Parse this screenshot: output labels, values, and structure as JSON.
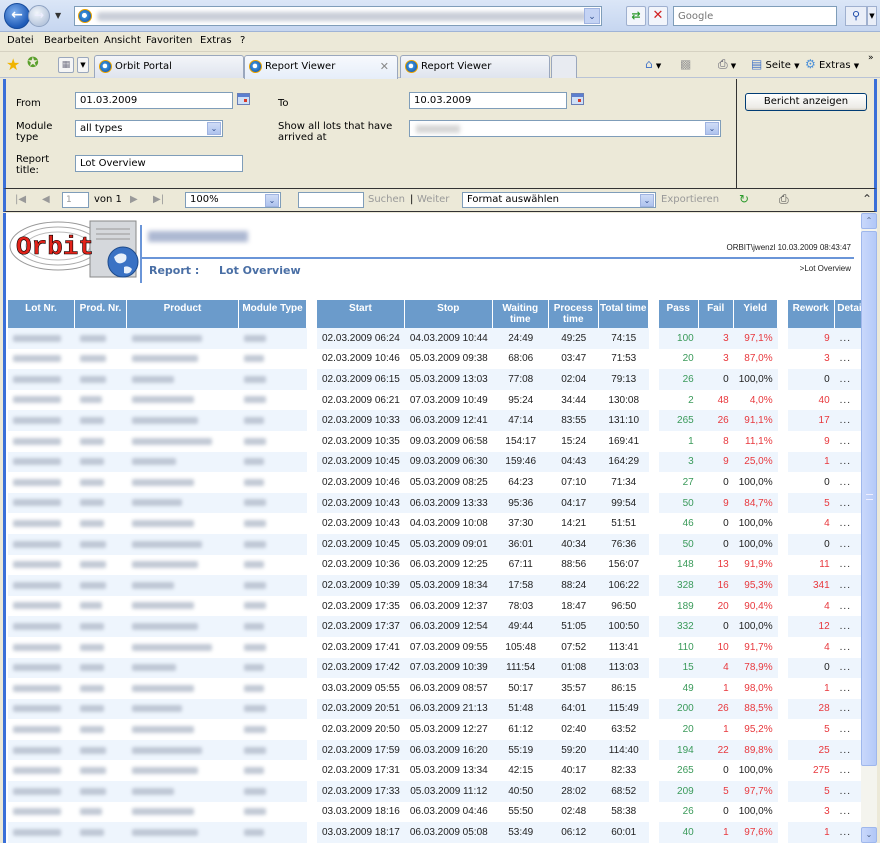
{
  "browser": {
    "address_placeholder": "",
    "search_placeholder": "Google",
    "menu": [
      "Datei",
      "Bearbeiten",
      "Ansicht",
      "Favoriten",
      "Extras",
      "?"
    ],
    "tabs": [
      {
        "label": "Orbit Portal",
        "active": false
      },
      {
        "label": "Report Viewer",
        "active": true
      },
      {
        "label": "Report Viewer",
        "active": false
      }
    ],
    "commands": {
      "page": "Seite",
      "tools": "Extras"
    }
  },
  "params": {
    "from_label": "From",
    "from_value": "01.03.2009",
    "to_label": "To",
    "to_value": "10.03.2009",
    "module_type_label": "Module type",
    "module_type_value": "all types",
    "arrived_label": "Show all lots that have arrived at",
    "report_title_label": "Report title:",
    "report_title_value": "Lot Overview",
    "view_report_button": "Bericht anzeigen"
  },
  "toolbar": {
    "page_value": "1",
    "page_of": "von 1",
    "zoom": "100%",
    "find": "Suchen",
    "separator": "|",
    "next": "Weiter",
    "format": "Format auswählen",
    "export": "Exportieren"
  },
  "report": {
    "report_label": "Report :",
    "report_title": "Lot Overview",
    "user_stamp": "ORBIT\\jwenzl 10.03.2009 08:43:47",
    "breadcrumb": ">Lot Overview",
    "logo_text": "Orbit",
    "columns": [
      "Lot Nr.",
      "Prod. Nr.",
      "Product",
      "Module Type",
      "Start",
      "Stop",
      "Waiting time",
      "Process time",
      "Total time",
      "Pass",
      "Fail",
      "Yield",
      "Rework",
      "Details"
    ],
    "details_label": "...",
    "rows": [
      {
        "start": "02.03.2009 06:24",
        "stop": "04.03.2009 10:44",
        "wait": "24:49",
        "proc": "49:25",
        "total": "74:15",
        "pass": "100",
        "fail": "3",
        "yield": "97,1%",
        "rework": "9"
      },
      {
        "start": "02.03.2009 10:46",
        "stop": "05.03.2009 09:38",
        "wait": "68:06",
        "proc": "03:47",
        "total": "71:53",
        "pass": "20",
        "fail": "3",
        "yield": "87,0%",
        "rework": "3"
      },
      {
        "start": "02.03.2009 06:15",
        "stop": "05.03.2009 13:03",
        "wait": "77:08",
        "proc": "02:04",
        "total": "79:13",
        "pass": "26",
        "fail": "0",
        "yield": "100,0%",
        "rework": "0"
      },
      {
        "start": "02.03.2009 06:21",
        "stop": "07.03.2009 10:49",
        "wait": "95:24",
        "proc": "34:44",
        "total": "130:08",
        "pass": "2",
        "fail": "48",
        "yield": "4,0%",
        "rework": "40"
      },
      {
        "start": "02.03.2009 10:33",
        "stop": "06.03.2009 12:41",
        "wait": "47:14",
        "proc": "83:55",
        "total": "131:10",
        "pass": "265",
        "fail": "26",
        "yield": "91,1%",
        "rework": "17"
      },
      {
        "start": "02.03.2009 10:35",
        "stop": "09.03.2009 06:58",
        "wait": "154:17",
        "proc": "15:24",
        "total": "169:41",
        "pass": "1",
        "fail": "8",
        "yield": "11,1%",
        "rework": "9"
      },
      {
        "start": "02.03.2009 10:45",
        "stop": "09.03.2009 06:30",
        "wait": "159:46",
        "proc": "04:43",
        "total": "164:29",
        "pass": "3",
        "fail": "9",
        "yield": "25,0%",
        "rework": "1"
      },
      {
        "start": "02.03.2009 10:46",
        "stop": "05.03.2009 08:25",
        "wait": "64:23",
        "proc": "07:10",
        "total": "71:34",
        "pass": "27",
        "fail": "0",
        "yield": "100,0%",
        "rework": "0"
      },
      {
        "start": "02.03.2009 10:43",
        "stop": "06.03.2009 13:33",
        "wait": "95:36",
        "proc": "04:17",
        "total": "99:54",
        "pass": "50",
        "fail": "9",
        "yield": "84,7%",
        "rework": "5"
      },
      {
        "start": "02.03.2009 10:43",
        "stop": "04.03.2009 10:08",
        "wait": "37:30",
        "proc": "14:21",
        "total": "51:51",
        "pass": "46",
        "fail": "0",
        "yield": "100,0%",
        "rework": "4"
      },
      {
        "start": "02.03.2009 10:45",
        "stop": "05.03.2009 09:01",
        "wait": "36:01",
        "proc": "40:34",
        "total": "76:36",
        "pass": "50",
        "fail": "0",
        "yield": "100,0%",
        "rework": "0"
      },
      {
        "start": "02.03.2009 10:36",
        "stop": "06.03.2009 12:25",
        "wait": "67:11",
        "proc": "88:56",
        "total": "156:07",
        "pass": "148",
        "fail": "13",
        "yield": "91,9%",
        "rework": "11"
      },
      {
        "start": "02.03.2009 10:39",
        "stop": "05.03.2009 18:34",
        "wait": "17:58",
        "proc": "88:24",
        "total": "106:22",
        "pass": "328",
        "fail": "16",
        "yield": "95,3%",
        "rework": "341"
      },
      {
        "start": "02.03.2009 17:35",
        "stop": "06.03.2009 12:37",
        "wait": "78:03",
        "proc": "18:47",
        "total": "96:50",
        "pass": "189",
        "fail": "20",
        "yield": "90,4%",
        "rework": "4"
      },
      {
        "start": "02.03.2009 17:37",
        "stop": "06.03.2009 12:54",
        "wait": "49:44",
        "proc": "51:05",
        "total": "100:50",
        "pass": "332",
        "fail": "0",
        "yield": "100,0%",
        "rework": "12"
      },
      {
        "start": "02.03.2009 17:41",
        "stop": "07.03.2009 09:55",
        "wait": "105:48",
        "proc": "07:52",
        "total": "113:41",
        "pass": "110",
        "fail": "10",
        "yield": "91,7%",
        "rework": "4"
      },
      {
        "start": "02.03.2009 17:42",
        "stop": "07.03.2009 10:39",
        "wait": "111:54",
        "proc": "01:08",
        "total": "113:03",
        "pass": "15",
        "fail": "4",
        "yield": "78,9%",
        "rework": "0"
      },
      {
        "start": "03.03.2009 05:55",
        "stop": "06.03.2009 08:57",
        "wait": "50:17",
        "proc": "35:57",
        "total": "86:15",
        "pass": "49",
        "fail": "1",
        "yield": "98,0%",
        "rework": "1"
      },
      {
        "start": "02.03.2009 20:51",
        "stop": "06.03.2009 21:13",
        "wait": "51:48",
        "proc": "64:01",
        "total": "115:49",
        "pass": "200",
        "fail": "26",
        "yield": "88,5%",
        "rework": "28"
      },
      {
        "start": "02.03.2009 20:50",
        "stop": "05.03.2009 12:27",
        "wait": "61:12",
        "proc": "02:40",
        "total": "63:52",
        "pass": "20",
        "fail": "1",
        "yield": "95,2%",
        "rework": "5"
      },
      {
        "start": "02.03.2009 17:59",
        "stop": "06.03.2009 16:20",
        "wait": "55:19",
        "proc": "59:20",
        "total": "114:40",
        "pass": "194",
        "fail": "22",
        "yield": "89,8%",
        "rework": "25"
      },
      {
        "start": "02.03.2009 17:31",
        "stop": "05.03.2009 13:34",
        "wait": "42:15",
        "proc": "40:17",
        "total": "82:33",
        "pass": "265",
        "fail": "0",
        "yield": "100,0%",
        "rework": "275"
      },
      {
        "start": "02.03.2009 17:33",
        "stop": "05.03.2009 11:12",
        "wait": "40:50",
        "proc": "28:02",
        "total": "68:52",
        "pass": "209",
        "fail": "5",
        "yield": "97,7%",
        "rework": "5"
      },
      {
        "start": "03.03.2009 18:16",
        "stop": "06.03.2009 04:46",
        "wait": "55:50",
        "proc": "02:48",
        "total": "58:38",
        "pass": "26",
        "fail": "0",
        "yield": "100,0%",
        "rework": "3"
      },
      {
        "start": "03.03.2009 18:17",
        "stop": "06.03.2009 05:08",
        "wait": "53:49",
        "proc": "06:12",
        "total": "60:01",
        "pass": "40",
        "fail": "1",
        "yield": "97,6%",
        "rework": "1"
      }
    ]
  },
  "colors": {
    "header_bg": "#6b9bcb",
    "row_alt_bg": "#eef5fd",
    "pass": "#3a9a5a",
    "fail": "#e8383d",
    "accent_line": "#6a95d8",
    "title_text": "#4a6fa5"
  }
}
